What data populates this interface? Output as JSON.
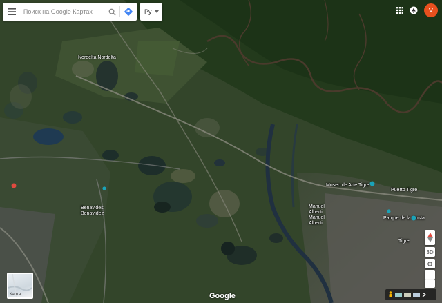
{
  "search": {
    "placeholder": "Поиск на Google Картах"
  },
  "language": {
    "selected": "Ру"
  },
  "account": {
    "initial": "V"
  },
  "map_labels": [
    {
      "text": "Nordelta Nordelta"
    },
    {
      "text": "Museo de Arte Tigre"
    },
    {
      "text": "Benavides Benavídez"
    },
    {
      "text": "Manuel Alberti Manuel Alberti"
    },
    {
      "text": "Parque de la Costa"
    },
    {
      "text": "Tigre"
    },
    {
      "text": "Puerto Tigre"
    }
  ],
  "controls": {
    "view_3d": "3D",
    "zoom_in": "+",
    "zoom_out": "−"
  },
  "layers": {
    "thumbnail_label": "Карта"
  },
  "brand": {
    "logo": "Google"
  },
  "icons": {
    "menu": "menu-icon",
    "search": "search-icon",
    "directions": "directions-icon",
    "apps": "apps-grid-icon",
    "notifications": "notifications-icon",
    "pegman": "pegman-icon",
    "compass": "compass-icon"
  },
  "colors": {
    "avatar": "#e8501e",
    "directions": "#4285f4",
    "pin_red": "#e04a3f",
    "pin_teal": "#1aa3b8"
  }
}
